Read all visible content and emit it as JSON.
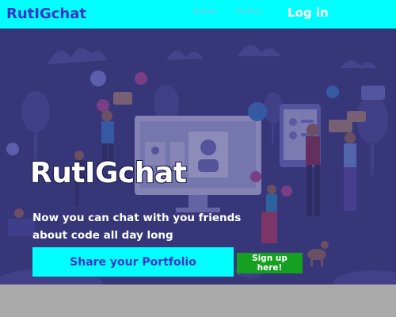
{
  "nav": {
    "brand": "RutIGchat",
    "links": [
      "About",
      "Policy"
    ],
    "login": "Log in"
  },
  "hero": {
    "title": "RutIGchat",
    "tagline": "Now you can chat with you friends about code all day long",
    "primary_button": "Share your Portfolio",
    "secondary_button": "Sign up here!"
  },
  "colors": {
    "nav_background": "#00ffff",
    "brand": "#3c34c8",
    "hero_overlay": "#343078",
    "signup": "#15a020",
    "footer": "#aaaaaa"
  }
}
